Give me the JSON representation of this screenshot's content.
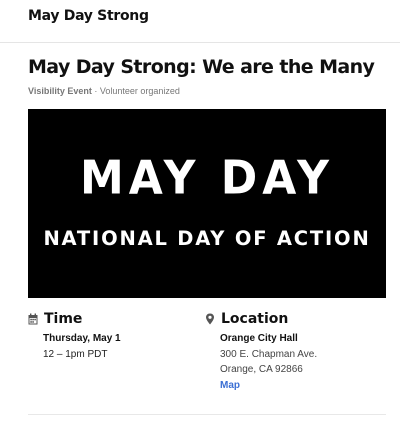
{
  "header": {
    "brand": "May Day Strong"
  },
  "event": {
    "title": "May Day Strong: We are the Many",
    "type": "Visibility Event",
    "separator": " · ",
    "organizer": "Volunteer organized",
    "banner": {
      "line1": "MAY DAY",
      "line2": "NATIONAL DAY OF ACTION"
    },
    "time": {
      "heading": "Time",
      "date": "Thursday, May 1",
      "hours": "12 – 1pm PDT",
      "icon": "calendar-icon"
    },
    "location": {
      "heading": "Location",
      "venue": "Orange City Hall",
      "street": "300 E. Chapman Ave.",
      "city": "Orange, CA 92866",
      "map_link": "Map",
      "icon": "map-pin-icon"
    }
  },
  "colors": {
    "link": "#3b6fd4",
    "banner_bg": "#000000",
    "text": "#111111",
    "muted": "#777777"
  }
}
